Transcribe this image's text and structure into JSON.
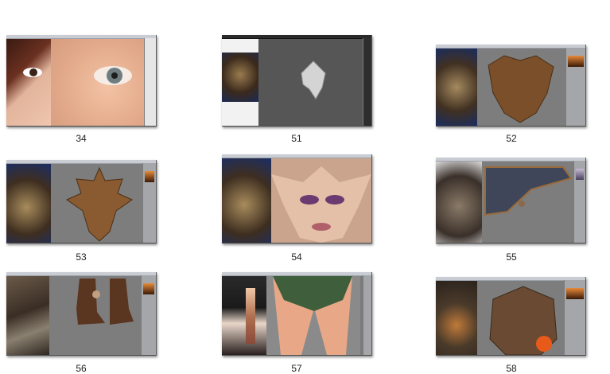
{
  "thumbnails": [
    {
      "label": "34"
    },
    {
      "label": "51"
    },
    {
      "label": "52"
    },
    {
      "label": "53"
    },
    {
      "label": "54"
    },
    {
      "label": "55"
    },
    {
      "label": "56"
    },
    {
      "label": "57"
    },
    {
      "label": "58"
    }
  ],
  "colors": {
    "background": "#ffffff",
    "canvas_gray": "#7d7d7d",
    "skin": "#e8b89a",
    "bronze": "#7a4f2a",
    "leather": "#5a3520",
    "green": "#3f5e3c"
  }
}
